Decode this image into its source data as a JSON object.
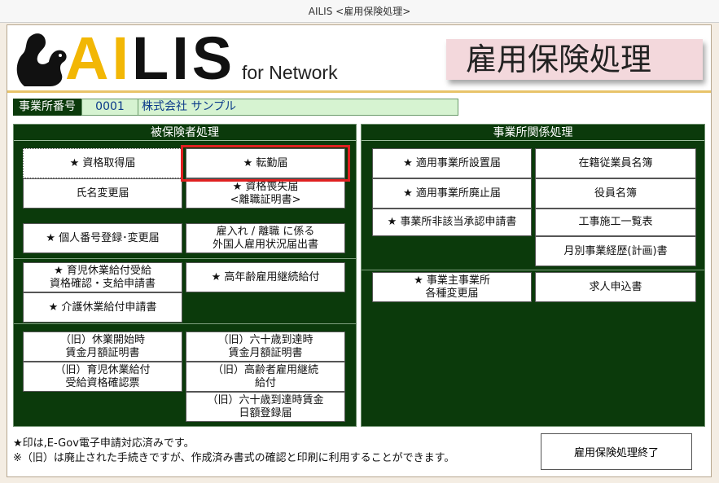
{
  "window": {
    "title": "AILIS <雇用保険処理>"
  },
  "logo": {
    "ai": "AI",
    "lis": "LIS",
    "subtitle": "for Network"
  },
  "page_title": "雇用保険処理",
  "office": {
    "label": "事業所番号",
    "number": "0001",
    "name": "株式会社 サンプル"
  },
  "left_panel": {
    "title": "被保険者処理",
    "buttons": [
      "★ 資格取得届",
      "★ 転勤届",
      "氏名変更届",
      "★ 資格喪失届\n<離職証明書>",
      "★ 個人番号登録･変更届",
      "雇入れ / 離職 に係る\n外国人雇用状況届出書",
      "★ 育児休業給付受給\n資格確認・支給申請書",
      "★ 高年齢雇用継続給付",
      "★ 介護休業給付申請書",
      "（旧）休業開始時\n賃金月額証明書",
      "（旧）六十歳到達時\n賃金月額証明書",
      "（旧）育児休業給付\n受給資格確認票",
      "（旧）高齢者雇用継続\n給付",
      "（旧）六十歳到達時賃金\n日額登録届"
    ]
  },
  "right_panel": {
    "title": "事業所関係処理",
    "buttons": [
      "★ 適用事業所設置届",
      "在籍従業員名簿",
      "★ 適用事業所廃止届",
      "役員名簿",
      "★ 事業所非該当承認申請書",
      "工事施工一覧表",
      "月別事業経歴(計画)書",
      "★ 事業主事業所\n各種変更届",
      "求人申込書"
    ]
  },
  "notes": {
    "line1": "★印は,E-Gov電子申請対応済みです。",
    "line2": "※（旧）は廃止された手続きですが、作成済み書式の確認と印刷に利用することができます。"
  },
  "end_button": "雇用保険処理終了"
}
